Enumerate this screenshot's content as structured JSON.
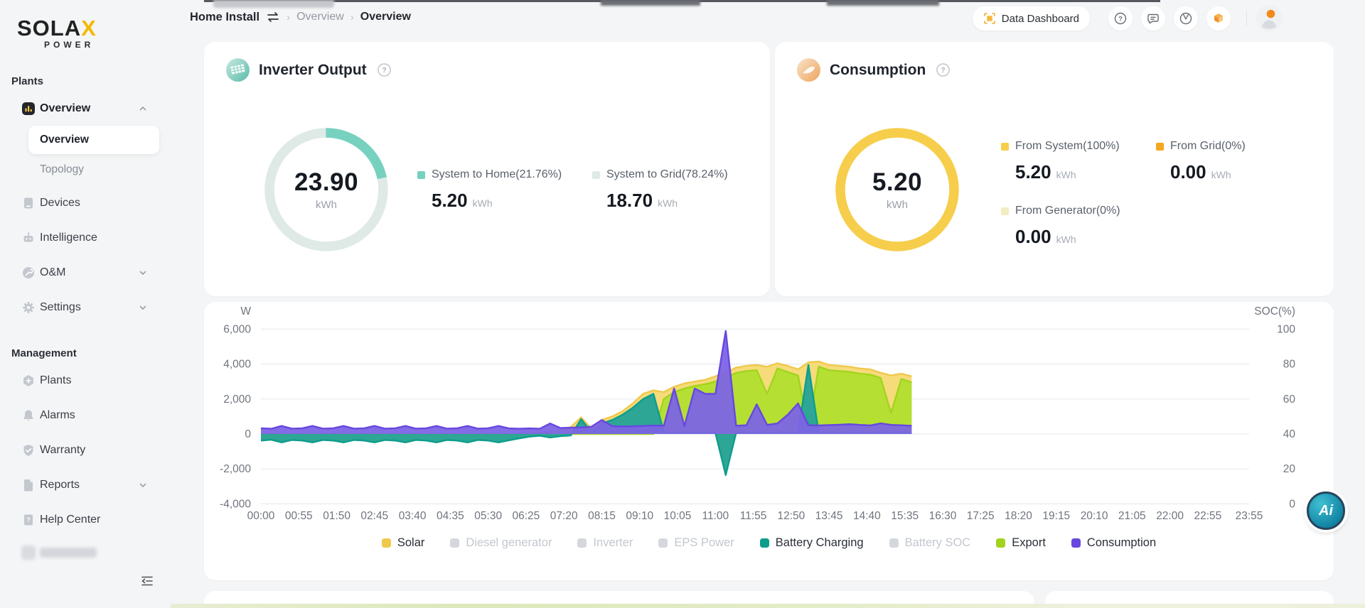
{
  "brand": {
    "name": "SOLA",
    "x": "X",
    "sub": "POWER"
  },
  "sidebar": {
    "sections": [
      {
        "label": "Plants",
        "items": [
          {
            "label": "Overview",
            "icon": "overview-icon",
            "active": true,
            "expandable": true,
            "expanded": true,
            "children": [
              {
                "label": "Overview",
                "selected": true
              },
              {
                "label": "Topology",
                "selected": false
              }
            ]
          },
          {
            "label": "Devices",
            "icon": "devices-icon"
          },
          {
            "label": "Intelligence",
            "icon": "intelligence-icon"
          },
          {
            "label": "O&M",
            "icon": "om-icon",
            "expandable": true,
            "expanded": false
          },
          {
            "label": "Settings",
            "icon": "settings-icon",
            "expandable": true,
            "expanded": false
          }
        ]
      },
      {
        "label": "Management",
        "items": [
          {
            "label": "Plants",
            "icon": "plants-icon"
          },
          {
            "label": "Alarms",
            "icon": "alarms-icon"
          },
          {
            "label": "Warranty",
            "icon": "warranty-icon"
          },
          {
            "label": "Reports",
            "icon": "reports-icon",
            "expandable": true,
            "expanded": false
          },
          {
            "label": "Help Center",
            "icon": "help-center-icon"
          },
          {
            "label": "",
            "icon": "redacted-icon",
            "redacted": true
          }
        ]
      }
    ]
  },
  "header": {
    "breadcrumb": {
      "plant": "Home Install",
      "path_mid": "Overview",
      "path_current": "Overview",
      "separator": "›"
    },
    "data_dashboard_label": "Data Dashboard",
    "icon_buttons": [
      {
        "name": "help-icon"
      },
      {
        "name": "feedback-icon"
      },
      {
        "name": "clock-icon"
      },
      {
        "name": "apps-icon"
      }
    ]
  },
  "cards": {
    "inverter_output": {
      "title": "Inverter Output",
      "value": "23.90",
      "unit": "kWh",
      "segments": [
        {
          "label": "System to Home(21.76%)",
          "value": "5.20",
          "unit": "kWh",
          "percent": 21.76,
          "color": "#77D1BF"
        },
        {
          "label": "System to Grid(78.24%)",
          "value": "18.70",
          "unit": "kWh",
          "percent": 78.24,
          "color": "#DFEAE7"
        }
      ]
    },
    "consumption": {
      "title": "Consumption",
      "value": "5.20",
      "unit": "kWh",
      "segments": [
        {
          "label": "From System(100%)",
          "value": "5.20",
          "unit": "kWh",
          "percent": 100,
          "color": "#F6CE4B"
        },
        {
          "label": "From Grid(0%)",
          "value": "0.00",
          "unit": "kWh",
          "percent": 0,
          "color": "#F5A623"
        },
        {
          "label": "From Generator(0%)",
          "value": "0.00",
          "unit": "kWh",
          "percent": 0,
          "color": "#F3ECC0"
        }
      ]
    }
  },
  "chart_data": {
    "type": "area",
    "unit_left": "W",
    "unit_right": "SOC(%)",
    "ylim": [
      -4000,
      6000
    ],
    "yticks": [
      6000,
      4000,
      2000,
      0,
      -2000,
      -4000
    ],
    "ytick_labels_left": [
      "6,000",
      "4,000",
      "2,000",
      "0",
      "-2,000",
      "-4,000"
    ],
    "y2lim": [
      0,
      100
    ],
    "ytick_labels_right": [
      "100",
      "80",
      "60",
      "40",
      "20",
      "0"
    ],
    "grid": true,
    "legend_position": "bottom",
    "x_total_minutes": 1435,
    "step_minutes": 15,
    "data_end_time": "15:45",
    "x_tick_minutes": [
      0,
      55,
      110,
      165,
      220,
      275,
      330,
      385,
      440,
      495,
      550,
      605,
      660,
      715,
      770,
      825,
      880,
      935,
      990,
      1045,
      1100,
      1155,
      1210,
      1265,
      1320,
      1375,
      1435
    ],
    "x_tick_labels": [
      "00:00",
      "00:55",
      "01:50",
      "02:45",
      "03:40",
      "04:35",
      "05:30",
      "06:25",
      "07:20",
      "08:15",
      "09:10",
      "10:05",
      "11:00",
      "11:55",
      "12:50",
      "13:45",
      "14:40",
      "15:35",
      "16:30",
      "17:25",
      "18:20",
      "19:15",
      "20:10",
      "21:05",
      "22:00",
      "22:55",
      "23:55"
    ],
    "series": [
      {
        "name": "Solar",
        "active": true,
        "z": 1,
        "color": "#EFC94C",
        "fill": "#F6DB7A",
        "opacity": 1,
        "values": [
          0,
          0,
          0,
          0,
          0,
          0,
          0,
          0,
          0,
          0,
          0,
          0,
          0,
          0,
          0,
          0,
          0,
          0,
          0,
          0,
          0,
          0,
          0,
          0,
          0,
          0,
          30,
          60,
          120,
          200,
          400,
          950,
          300,
          800,
          1000,
          1300,
          1750,
          2300,
          2500,
          2400,
          2700,
          2900,
          3000,
          3100,
          3300,
          3500,
          3800,
          3900,
          3950,
          3850,
          4050,
          3900,
          3700,
          4100,
          4150,
          3950,
          3900,
          3850,
          3750,
          3700,
          3500,
          3350,
          3450,
          3300
        ]
      },
      {
        "name": "Diesel generator",
        "active": false,
        "color": "#D4D7DC",
        "values": []
      },
      {
        "name": "Inverter",
        "active": false,
        "color": "#D4D7DC",
        "values": []
      },
      {
        "name": "EPS Power",
        "active": false,
        "color": "#D4D7DC",
        "values": []
      },
      {
        "name": "Battery Charging",
        "active": true,
        "z": 3,
        "color": "#0E9D8C",
        "fill": "#2EA695",
        "opacity": 1,
        "values": [
          -380,
          -330,
          -480,
          -340,
          -380,
          -480,
          -340,
          -380,
          -480,
          -340,
          -380,
          -480,
          -340,
          -380,
          -480,
          -340,
          -380,
          -480,
          -340,
          -380,
          -480,
          -340,
          -380,
          -480,
          -360,
          -250,
          -150,
          -100,
          -200,
          -120,
          -80,
          850,
          100,
          600,
          800,
          1100,
          1500,
          2000,
          2300,
          120,
          60,
          60,
          60,
          60,
          60,
          -2350,
          60,
          60,
          60,
          60,
          60,
          60,
          60,
          3950,
          60,
          60,
          60,
          60,
          60,
          60,
          60,
          60,
          60,
          50
        ]
      },
      {
        "name": "Battery SOC",
        "active": false,
        "color": "#D4D7DC",
        "values": []
      },
      {
        "name": "Export",
        "active": true,
        "z": 2,
        "color": "#A2D41C",
        "fill": "#B5E033",
        "opacity": 1,
        "values": [
          0,
          0,
          0,
          0,
          0,
          0,
          0,
          0,
          0,
          0,
          0,
          0,
          0,
          0,
          0,
          0,
          0,
          0,
          0,
          0,
          0,
          0,
          0,
          0,
          0,
          0,
          0,
          0,
          0,
          0,
          0,
          0,
          0,
          0,
          0,
          0,
          0,
          0,
          0,
          2000,
          2400,
          2600,
          2750,
          2850,
          3000,
          3200,
          3500,
          3600,
          3650,
          2300,
          3750,
          3550,
          3350,
          300,
          3850,
          3650,
          3600,
          3550,
          3450,
          3400,
          3200,
          1200,
          3150,
          2950
        ]
      },
      {
        "name": "Consumption",
        "active": true,
        "z": 4,
        "color": "#6847E0",
        "fill": "#7C64E4",
        "opacity": 0.95,
        "values": [
          330,
          300,
          460,
          310,
          330,
          460,
          310,
          330,
          460,
          310,
          330,
          460,
          310,
          330,
          460,
          310,
          330,
          460,
          310,
          330,
          460,
          310,
          330,
          460,
          320,
          300,
          320,
          300,
          600,
          340,
          360,
          380,
          420,
          800,
          450,
          430,
          440,
          460,
          480,
          470,
          2600,
          460,
          2600,
          2300,
          2300,
          5900,
          470,
          500,
          1700,
          520,
          600,
          1100,
          1750,
          500,
          490,
          510,
          530,
          560,
          520,
          490,
          610,
          520,
          500,
          470
        ]
      }
    ]
  },
  "ai_button": {
    "label": "Ai"
  }
}
